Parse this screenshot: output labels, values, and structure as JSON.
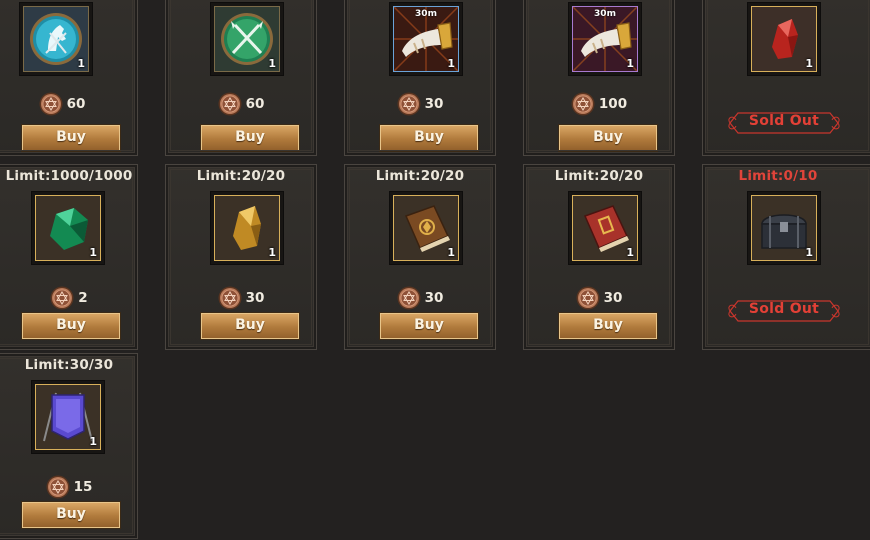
{
  "cards": [
    {
      "limit": "",
      "item_icon": "horse-emblem-icon",
      "timer": "",
      "quantity": "1",
      "price": "60",
      "action": "Buy"
    },
    {
      "limit": "",
      "item_icon": "crossed-spears-emblem-icon",
      "timer": "",
      "quantity": "1",
      "price": "60",
      "action": "Buy"
    },
    {
      "limit": "",
      "item_icon": "war-horn-icon",
      "timer": "30m",
      "quantity": "1",
      "price": "30",
      "action": "Buy"
    },
    {
      "limit": "",
      "item_icon": "war-horn-icon",
      "timer": "30m",
      "quantity": "1",
      "price": "100",
      "action": "Buy"
    },
    {
      "limit": "",
      "item_icon": "red-crystal-icon",
      "timer": "",
      "quantity": "1",
      "price": "",
      "action": "Sold Out"
    },
    {
      "limit": "Limit:1000/1000",
      "item_icon": "green-gem-icon",
      "timer": "",
      "quantity": "1",
      "price": "2",
      "action": "Buy"
    },
    {
      "limit": "Limit:20/20",
      "item_icon": "gold-crystal-icon",
      "timer": "",
      "quantity": "1",
      "price": "30",
      "action": "Buy"
    },
    {
      "limit": "Limit:20/20",
      "item_icon": "brown-tome-icon",
      "timer": "",
      "quantity": "1",
      "price": "30",
      "action": "Buy"
    },
    {
      "limit": "Limit:20/20",
      "item_icon": "red-tome-icon",
      "timer": "",
      "quantity": "1",
      "price": "30",
      "action": "Buy"
    },
    {
      "limit": "Limit:0/10",
      "item_icon": "treasure-chest-icon",
      "timer": "",
      "quantity": "1",
      "price": "",
      "action": "Sold Out"
    },
    {
      "limit": "Limit:30/30",
      "item_icon": "purple-banner-icon",
      "timer": "",
      "quantity": "1",
      "price": "15",
      "action": "Buy"
    }
  ],
  "colors": {
    "background": "#232120",
    "card": "#2f2c29",
    "buy_button": "#b07a3c",
    "sold_out": "#e34036",
    "limit_reached": "#e0443a"
  }
}
